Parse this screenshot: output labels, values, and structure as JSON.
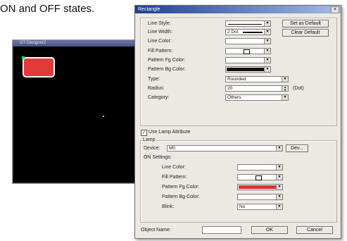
{
  "caption": "ON and OFF states.",
  "editor": {
    "title": "GT Designer2",
    "lamp_color": "#e23a3a"
  },
  "dialog": {
    "title": "Rectangle",
    "close_symbol": "×",
    "line_style_label": "Line Style:",
    "line_width_label": "Line Width:",
    "line_width_value": "2 Dot",
    "line_color_label": "Line Color:",
    "fill_pattern_label": "Fill Pattern:",
    "pattern_fg_label": "Pattern Fg Color:",
    "pattern_bg_label": "Pattern Bg Color:",
    "type_label": "Type:",
    "type_value": "Rounded",
    "radius_label": "Radius:",
    "radius_value": "20",
    "radius_unit": "(Dot)",
    "category_label": "Category:",
    "category_value": "Others",
    "set_default_button": "Set as Default",
    "clear_default_button": "Clear Default",
    "use_lamp_label": "Use Lamp Attribute",
    "lamp_group_label": "Lamp",
    "device_label": "Device:",
    "device_value": "M0",
    "dev_button": "Dev...",
    "on_settings_label": "ON Settings:",
    "on_line_color_label": "Line Color:",
    "on_fill_pattern_label": "Fill Pattern:",
    "on_pattern_fg_label": "Pattern Fg Color:",
    "on_pattern_bg_label": "Pattern Bg Color:",
    "blink_label": "Blink:",
    "blink_value": "No",
    "object_name_label": "Object Name:",
    "ok_button": "OK",
    "cancel_button": "Cancel",
    "pattern_bg_color": "#111111",
    "on_pattern_fg_color": "#e03030"
  }
}
